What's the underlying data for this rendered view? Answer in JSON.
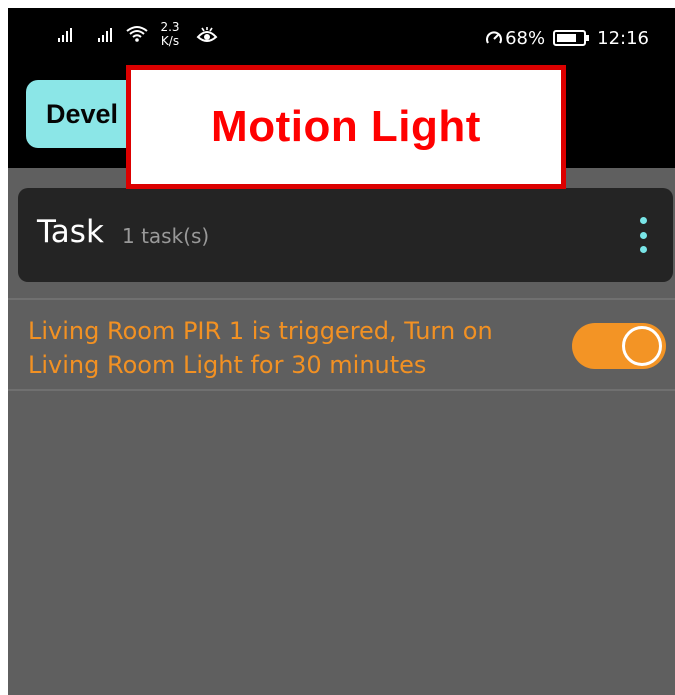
{
  "status_bar": {
    "net_speed": "2.3",
    "net_speed_unit": "K/s",
    "speed_mode_icon": "speedometer-icon",
    "battery_percent": "68%",
    "time": "12:16"
  },
  "app_bar": {
    "dev_button_label": "Devel"
  },
  "callout": {
    "text": "Motion Light",
    "border_color": "#dc0000",
    "text_color": "#ff0000"
  },
  "task": {
    "title": "Task",
    "count": "1 task(s)",
    "menu_icon": "more-vertical-icon"
  },
  "rule": {
    "text": "Living Room PIR 1 is triggered, Turn on Living Room Light for 30 minutes",
    "enabled": true,
    "accent_color": "#f39425"
  }
}
